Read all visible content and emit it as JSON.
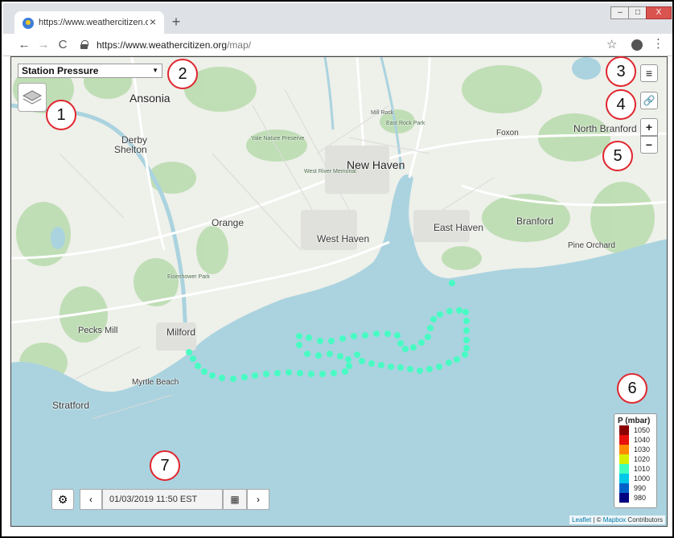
{
  "browser": {
    "tab_title": "https://www.weathercitizen.org/map/",
    "tab_close": "×",
    "new_tab": "+",
    "url_host": "https://www.weathercitizen.org",
    "url_path": "/map/",
    "window_buttons": {
      "minimize": "–",
      "maximize": "□",
      "close": "X"
    },
    "nav_icons": {
      "back": "←",
      "forward": "→",
      "reload": "C",
      "star": "☆",
      "menu": "⋮"
    }
  },
  "map": {
    "variable_select": {
      "label": "Station Pressure",
      "arrow": "▼"
    },
    "controls": {
      "list": "≡",
      "link": "🔗",
      "zoom_in": "+",
      "zoom_out": "−"
    },
    "places": [
      {
        "id": "ansonia",
        "label": "Ansonia"
      },
      {
        "id": "derby",
        "label": "Derby"
      },
      {
        "id": "shelton",
        "label": "Shelton"
      },
      {
        "id": "new-haven",
        "label": "New Haven"
      },
      {
        "id": "north-branford",
        "label": "North Branford"
      },
      {
        "id": "foxon",
        "label": "Foxon"
      },
      {
        "id": "orange",
        "label": "Orange"
      },
      {
        "id": "west-haven",
        "label": "West Haven"
      },
      {
        "id": "east-haven",
        "label": "East Haven"
      },
      {
        "id": "branford",
        "label": "Branford"
      },
      {
        "id": "pine-orchard",
        "label": "Pine Orchard"
      },
      {
        "id": "pecks-mill",
        "label": "Pecks Mill"
      },
      {
        "id": "milford",
        "label": "Milford"
      },
      {
        "id": "myrtle-beach",
        "label": "Myrtle Beach"
      },
      {
        "id": "stratford",
        "label": "Stratford"
      },
      {
        "id": "yale-nature-preserve",
        "label": "Yale Nature Preserve"
      },
      {
        "id": "west-river-memorial",
        "label": "West River Memorial"
      },
      {
        "id": "mill-rock",
        "label": "Mill Rock"
      },
      {
        "id": "east-rock-park",
        "label": "East Rock Park"
      },
      {
        "id": "eisenhower-park",
        "label": "Eisenhower Park"
      }
    ],
    "legend": {
      "title": "P (mbar)",
      "levels": [
        {
          "label": "1050",
          "color": "#8b0000"
        },
        {
          "label": "1040",
          "color": "#e8100c"
        },
        {
          "label": "1030",
          "color": "#ff8a00"
        },
        {
          "label": "1020",
          "color": "#d7f000"
        },
        {
          "label": "1010",
          "color": "#3dffc0"
        },
        {
          "label": "1000",
          "color": "#00c8e8"
        },
        {
          "label": "990",
          "color": "#0062c8"
        },
        {
          "label": "980",
          "color": "#000080"
        }
      ]
    },
    "track_color": "#3dffc0",
    "time_control": {
      "settings_icon": "⚙",
      "prev": "‹",
      "date": "01/03/2019 11:50 EST",
      "calendar_icon": "▦",
      "next": "›"
    },
    "attribution": {
      "leaflet": "Leaflet",
      "separator": " | © ",
      "mapbox": "Mapbox",
      "contributors": " Contributors"
    }
  },
  "callouts": [
    "1",
    "2",
    "3",
    "4",
    "5",
    "6",
    "7"
  ]
}
